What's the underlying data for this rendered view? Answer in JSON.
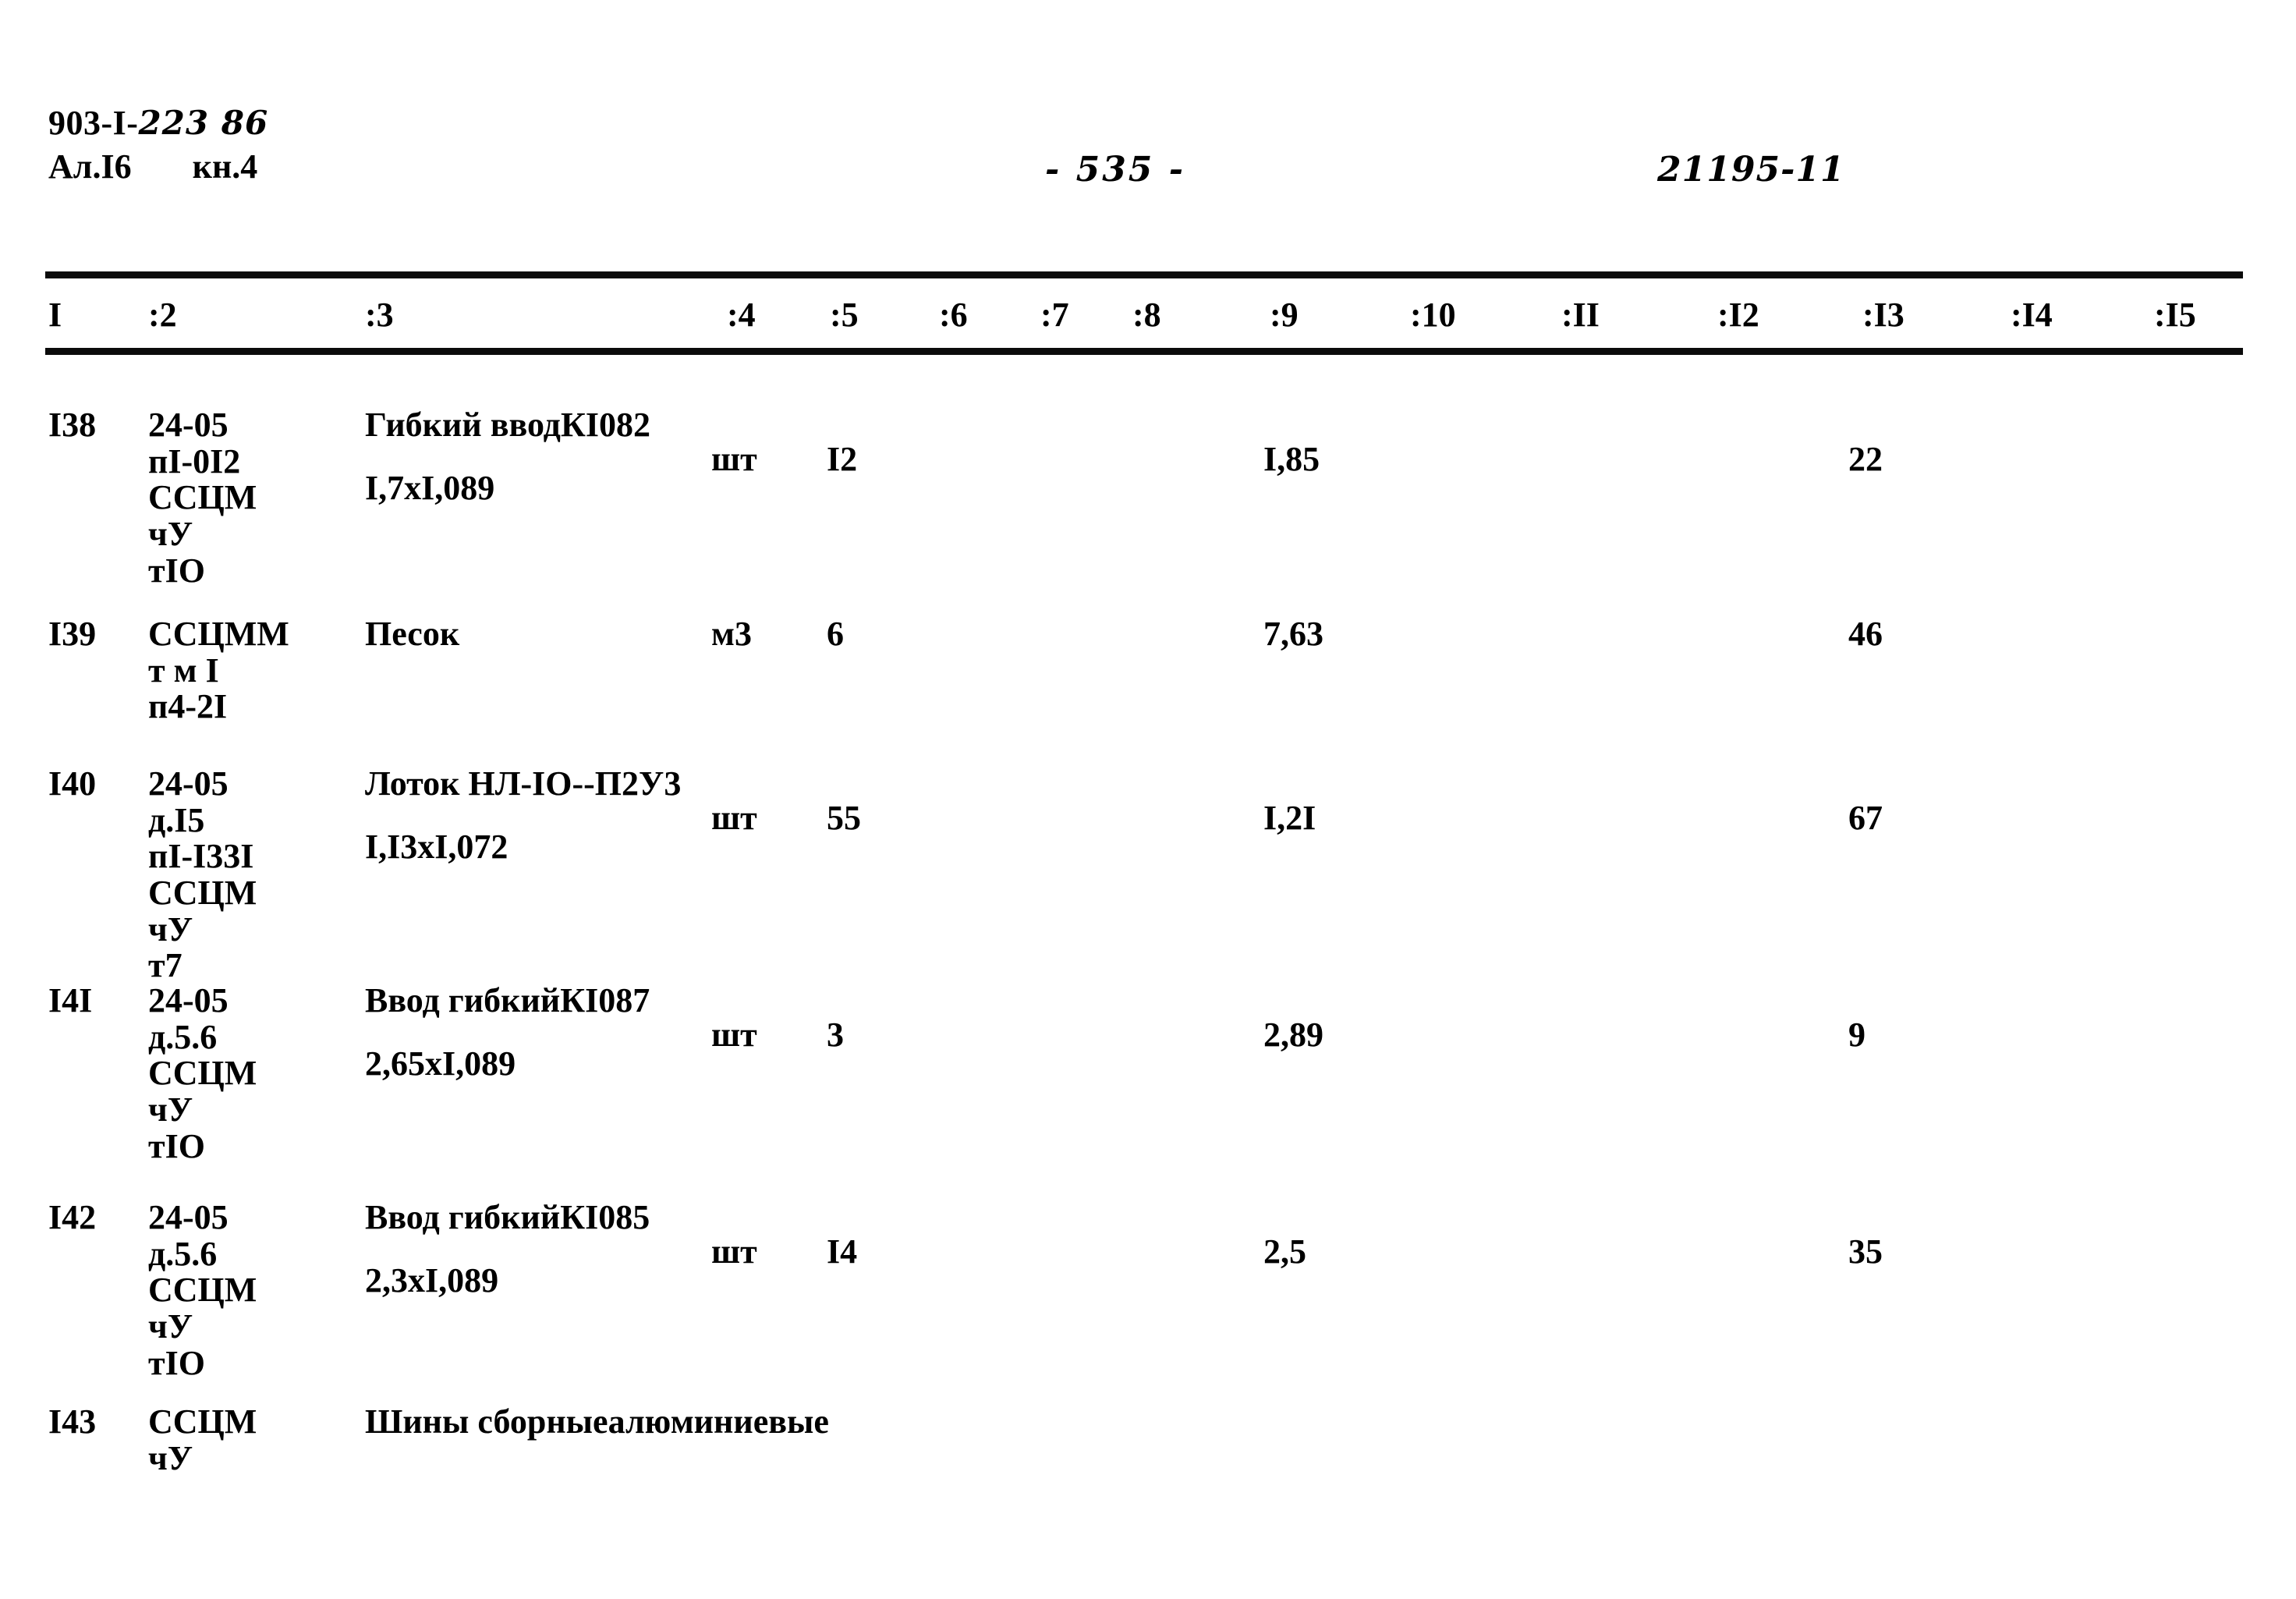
{
  "header": {
    "doc_code": "903-I-",
    "doc_code_hand": "223 86",
    "album_line": "Ал.I6",
    "book_line": "кн.4",
    "page_number": "- 535 -",
    "doc_number": "21195-11"
  },
  "table": {
    "columns": [
      "I",
      ":2",
      ":3",
      ":4",
      ":5",
      ":6",
      ":7",
      ":8",
      ":9",
      ":10",
      ":II",
      ":I2",
      ":I3",
      ":I4",
      ":I5"
    ],
    "rows": [
      {
        "num": "I38",
        "code_lines": [
          "24-05",
          "пI-0I2",
          "ССЦМ",
          "чУ",
          "тIO"
        ],
        "name_line1": "Гибкий ввод",
        "name_line2": "КI082",
        "name_spec": "I,7xI,089",
        "unit": "шт",
        "qty": "I2",
        "price": "I,85",
        "total": "22"
      },
      {
        "num": "I39",
        "code_lines": [
          "ССЦММ",
          "т м I",
          "п4-2I"
        ],
        "name_line1": "Песок",
        "name_line2": "",
        "name_spec": "",
        "unit": "м3",
        "qty": "6",
        "price": "7,63",
        "total": "46"
      },
      {
        "num": "I40",
        "code_lines": [
          "24-05",
          "д.I5",
          "пI-I33I",
          "ССЦМ",
          "чУ",
          "т7"
        ],
        "name_line1": "Лоток НЛ-IО-",
        "name_line2": "-П2У3",
        "name_spec": "I,I3xI,072",
        "unit": "шт",
        "qty": "55",
        "price": "I,2I",
        "total": "67"
      },
      {
        "num": "I4I",
        "code_lines": [
          "24-05",
          "д.5.6",
          "ССЦМ",
          "чУ",
          "тIO"
        ],
        "name_line1": "Ввод гибкий",
        "name_line2": "КI087",
        "name_spec": "2,65xI,089",
        "unit": "шт",
        "qty": "3",
        "price": "2,89",
        "total": "9"
      },
      {
        "num": "I42",
        "code_lines": [
          "24-05",
          "д.5.6",
          "ССЦМ",
          "чУ",
          "тIO"
        ],
        "name_line1": "Ввод гибкий",
        "name_line2": "КI085",
        "name_spec": "2,3xI,089",
        "unit": "шт",
        "qty": "I4",
        "price": "2,5",
        "total": "35"
      },
      {
        "num": "I43",
        "code_lines": [
          "ССЦМ",
          "чУ"
        ],
        "name_line1": "Шины сборные",
        "name_line2": "алюминиевые",
        "name_spec": "",
        "unit": "",
        "qty": "",
        "price": "",
        "total": ""
      }
    ]
  }
}
